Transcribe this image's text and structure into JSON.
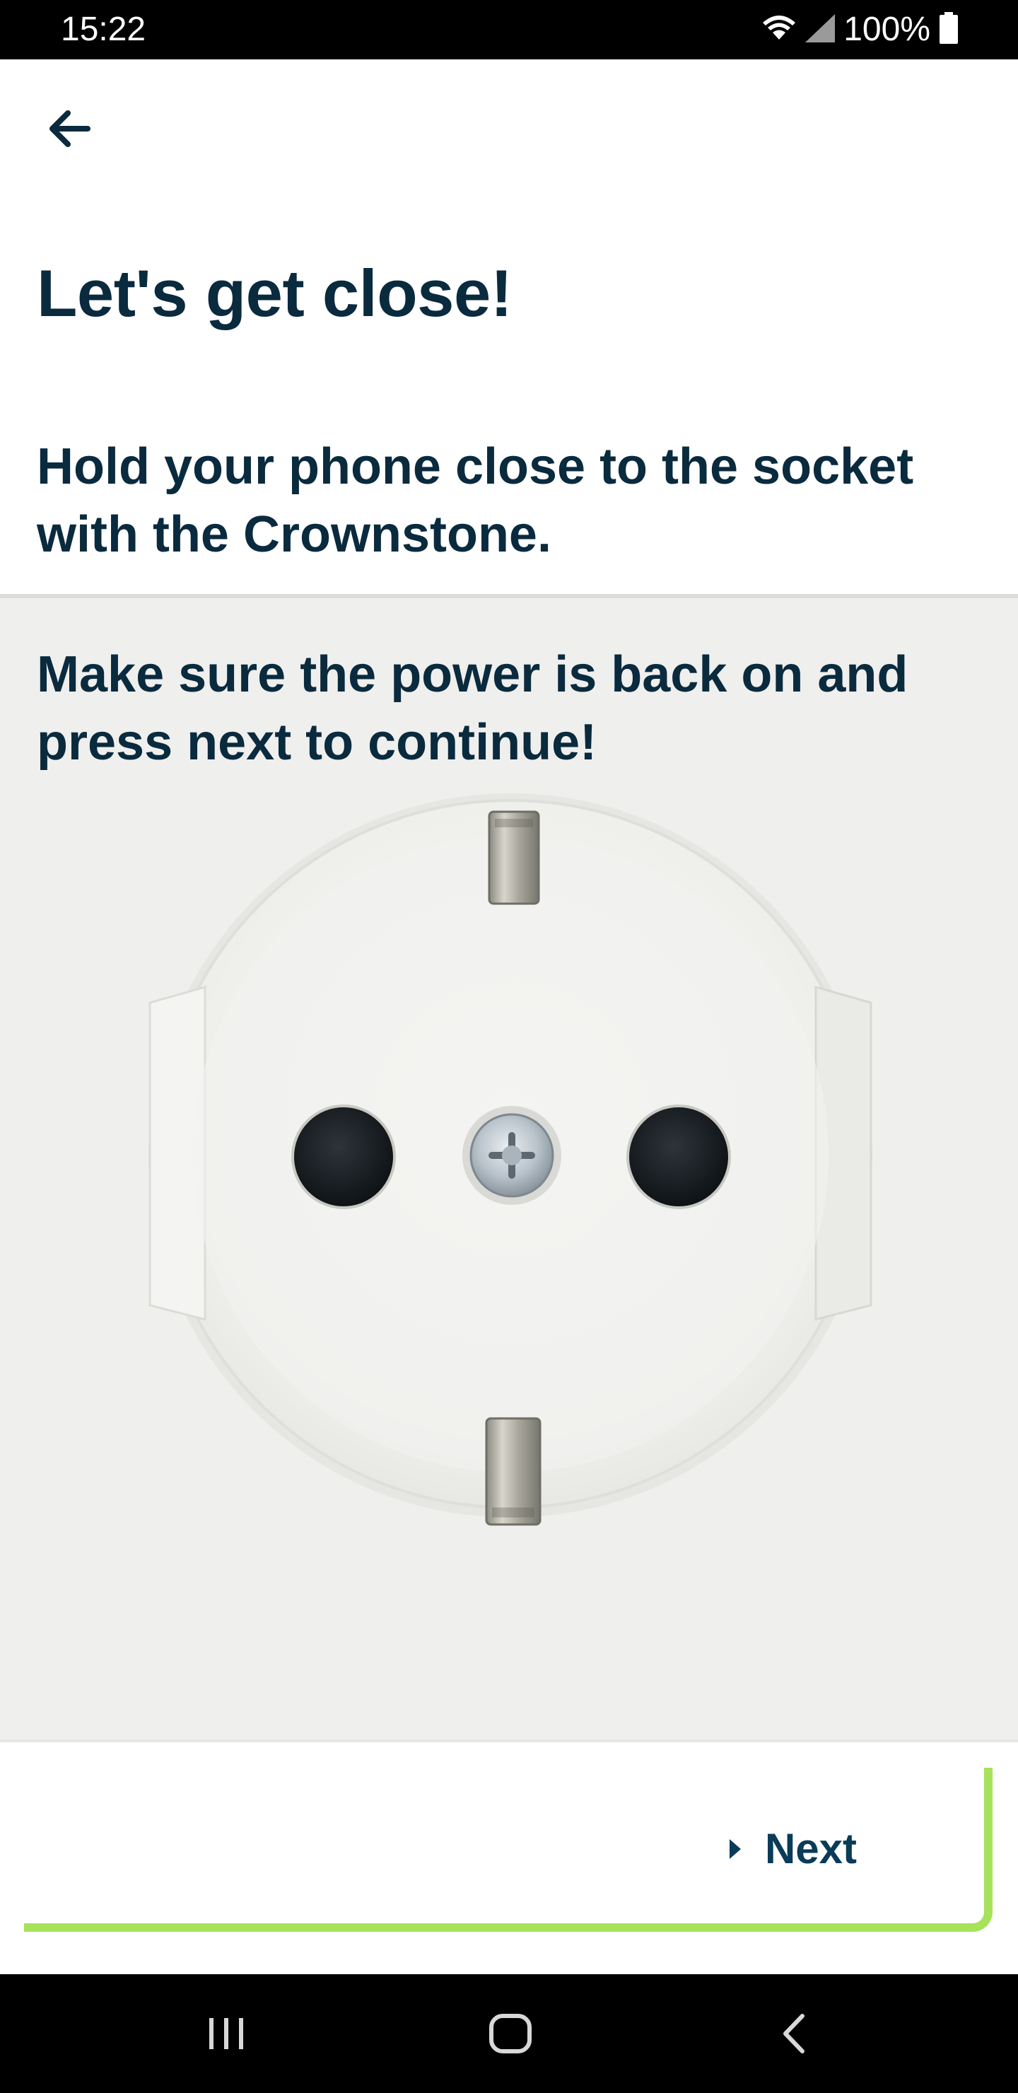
{
  "status_bar": {
    "time": "15:22",
    "battery": "100%",
    "icons": [
      "wifi-icon",
      "signal-icon",
      "battery-icon"
    ]
  },
  "header": {
    "back_icon": "arrow-left-icon"
  },
  "main": {
    "title": "Let's get close!",
    "instruction": "Hold your phone close to the socket with the Crownstone.",
    "power_note": "Make sure the power is back on and press next to continue!",
    "image": "wall-socket"
  },
  "footer": {
    "next_label": "Next",
    "next_icon": "caret-right-icon"
  },
  "nav_bar": {
    "icons": [
      "recent-apps-icon",
      "home-icon",
      "back-icon"
    ]
  },
  "colors": {
    "text_primary": "#0a2a3e",
    "button_text": "#0a3b58",
    "accent": "#a6e25a",
    "socket_background": "#efefed",
    "status_bar": "#000000"
  }
}
